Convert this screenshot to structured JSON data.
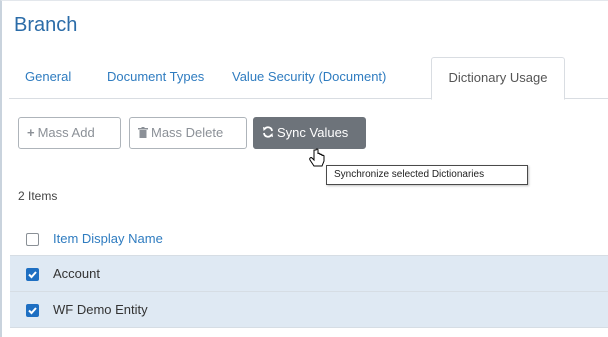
{
  "page": {
    "title": "Branch"
  },
  "tabs": [
    {
      "label": "General"
    },
    {
      "label": "Document Types"
    },
    {
      "label": "Value Security (Document)"
    },
    {
      "label": "Dictionary Usage"
    }
  ],
  "toolbar": {
    "mass_add": {
      "label": "Mass Add",
      "icon": "plus-icon"
    },
    "mass_delete": {
      "label": "Mass Delete",
      "icon": "trash-icon"
    },
    "sync_values": {
      "label": "Sync Values",
      "icon": "sync-icon"
    }
  },
  "tooltip": {
    "text": "Synchronize selected Dictionaries"
  },
  "list": {
    "count_label": "2 Items",
    "column_header": "Item Display Name",
    "rows": [
      {
        "name": "Account",
        "checked": true
      },
      {
        "name": "WF Demo Entity",
        "checked": true
      }
    ]
  },
  "colors": {
    "accent": "#2f7cc0",
    "checkbox": "#1e6fc2",
    "selected_row": "#dfe9f3",
    "primary_button": "#6d737a"
  }
}
